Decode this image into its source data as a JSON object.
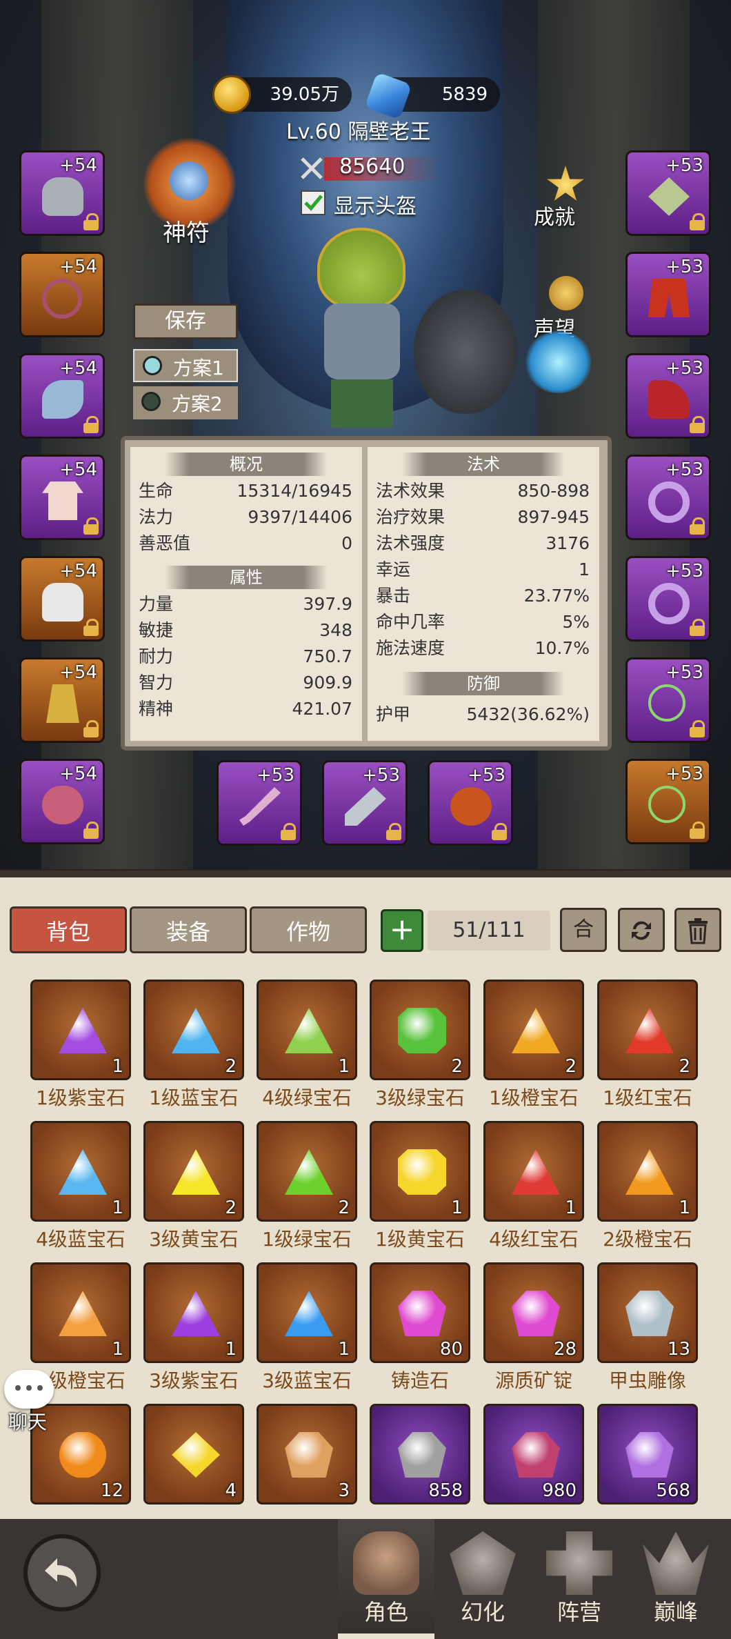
{
  "header": {
    "gold": "39.05万",
    "diamonds": "5839",
    "player_name": "Lv.60 隔壁老王",
    "power": "85640",
    "show_helmet_label": "显示头盔",
    "show_helmet_checked": true
  },
  "side_buttons": {
    "rune": "神符",
    "achievement": "成就",
    "reputation": "声望",
    "save": "保存",
    "plan1": "方案1",
    "plan2": "方案2"
  },
  "equipment": {
    "left": [
      "+54",
      "+54",
      "+54",
      "+54",
      "+54",
      "+54",
      "+54"
    ],
    "right": [
      "+53",
      "+53",
      "+53",
      "+53",
      "+53",
      "+53",
      "+53"
    ],
    "bottom": [
      "+53",
      "+53",
      "+53"
    ]
  },
  "stats": {
    "overview_title": "概况",
    "overview": [
      {
        "k": "生命",
        "v": "15314/16945"
      },
      {
        "k": "法力",
        "v": "9397/14406"
      },
      {
        "k": "善恶值",
        "v": "0"
      }
    ],
    "attr_title": "属性",
    "attributes": [
      {
        "k": "力量",
        "v": "397.9"
      },
      {
        "k": "敏捷",
        "v": "348"
      },
      {
        "k": "耐力",
        "v": "750.7"
      },
      {
        "k": "智力",
        "v": "909.9"
      },
      {
        "k": "精神",
        "v": "421.07"
      }
    ],
    "magic_title": "法术",
    "magic": [
      {
        "k": "法术效果",
        "v": "850-898"
      },
      {
        "k": "治疗效果",
        "v": "897-945"
      },
      {
        "k": "法术强度",
        "v": "3176"
      },
      {
        "k": "幸运",
        "v": "1"
      },
      {
        "k": "暴击",
        "v": "23.77%"
      },
      {
        "k": "命中几率",
        "v": "5%"
      },
      {
        "k": "施法速度",
        "v": "10.7%"
      }
    ],
    "defense_title": "防御",
    "defense": [
      {
        "k": "护甲",
        "v": "5432(36.62%)"
      }
    ]
  },
  "inventory": {
    "tabs": [
      "背包",
      "装备",
      "作物"
    ],
    "add": "+",
    "capacity": "51/111",
    "merge": "合",
    "items": [
      {
        "name": "1级紫宝石",
        "count": "1",
        "color": "#a24de0"
      },
      {
        "name": "1级蓝宝石",
        "count": "2",
        "color": "#4fb4f0"
      },
      {
        "name": "4级绿宝石",
        "count": "1",
        "color": "#8fd14f"
      },
      {
        "name": "3级绿宝石",
        "count": "2",
        "color": "#58c23a"
      },
      {
        "name": "1级橙宝石",
        "count": "2",
        "color": "#f2a822"
      },
      {
        "name": "1级红宝石",
        "count": "2",
        "color": "#e23a2a"
      },
      {
        "name": "4级蓝宝石",
        "count": "1",
        "color": "#5ab6ee"
      },
      {
        "name": "3级黄宝石",
        "count": "2",
        "color": "#f5e62a"
      },
      {
        "name": "1级绿宝石",
        "count": "2",
        "color": "#6cd12d"
      },
      {
        "name": "1级黄宝石",
        "count": "1",
        "color": "#f5d62a"
      },
      {
        "name": "4级红宝石",
        "count": "1",
        "color": "#e03a35"
      },
      {
        "name": "2级橙宝石",
        "count": "1",
        "color": "#f29a1e"
      },
      {
        "name": "4级橙宝石",
        "count": "1",
        "color": "#f2a040"
      },
      {
        "name": "3级紫宝石",
        "count": "1",
        "color": "#9b3fe0"
      },
      {
        "name": "3级蓝宝石",
        "count": "1",
        "color": "#3a9cf0"
      },
      {
        "name": "铸造石",
        "count": "80",
        "color": "#e04ad0"
      },
      {
        "name": "源质矿锭",
        "count": "28",
        "color": "#e04ad0"
      },
      {
        "name": "甲虫雕像",
        "count": "13",
        "color": "#b0c0c8"
      },
      {
        "name": "",
        "count": "12",
        "color": "#f08a1a"
      },
      {
        "name": "",
        "count": "4",
        "color": "#f5d62a"
      },
      {
        "name": "",
        "count": "3",
        "color": "#e0a060"
      },
      {
        "name": "",
        "count": "858",
        "color": "#a0a0a0"
      },
      {
        "name": "",
        "count": "980",
        "color": "#c04070"
      },
      {
        "name": "",
        "count": "568",
        "color": "#b070e0"
      }
    ]
  },
  "chat_label": "聊天",
  "nav": [
    "角色",
    "幻化",
    "阵营",
    "巅峰"
  ]
}
